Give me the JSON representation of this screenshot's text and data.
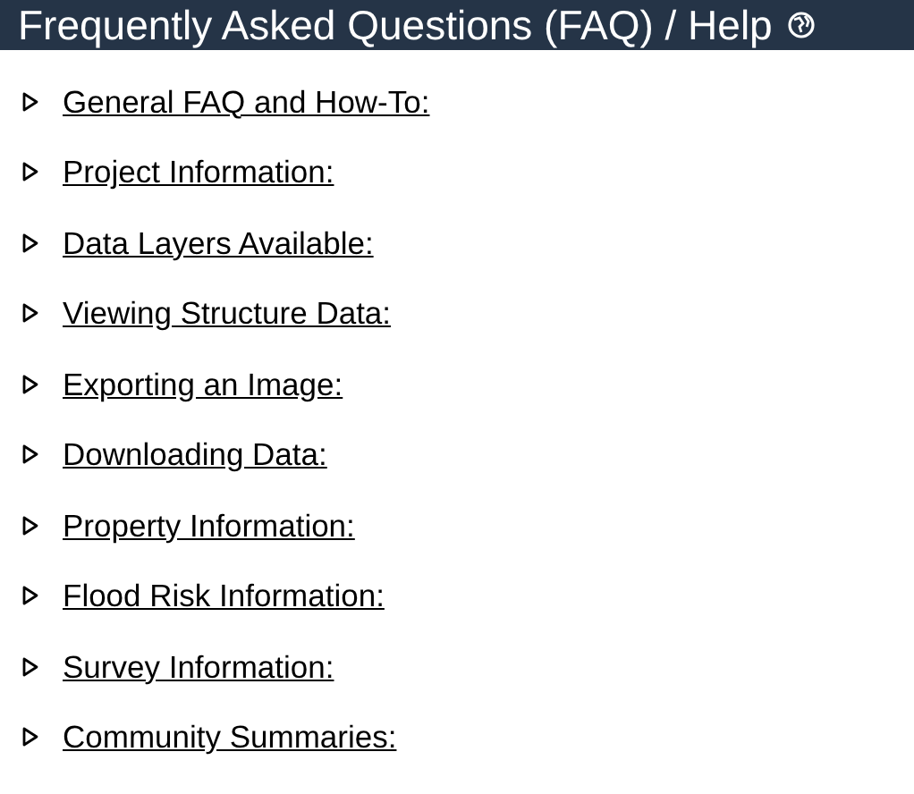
{
  "header": {
    "title": "Frequently Asked Questions (FAQ) / Help"
  },
  "items": [
    {
      "label": "General FAQ and How-To:",
      "expanded": false
    },
    {
      "label": "Project Information:",
      "expanded": false
    },
    {
      "label": "Data Layers Available:",
      "expanded": false
    },
    {
      "label": "Viewing Structure Data:",
      "expanded": false
    },
    {
      "label": "Exporting an Image:",
      "expanded": false
    },
    {
      "label": "Downloading Data:",
      "expanded": false
    },
    {
      "label": "Property Information:",
      "expanded": false
    },
    {
      "label": "Flood Risk Information:",
      "expanded": false
    },
    {
      "label": "Survey Information:",
      "expanded": false
    },
    {
      "label": "Community Summaries:",
      "expanded": false
    }
  ]
}
